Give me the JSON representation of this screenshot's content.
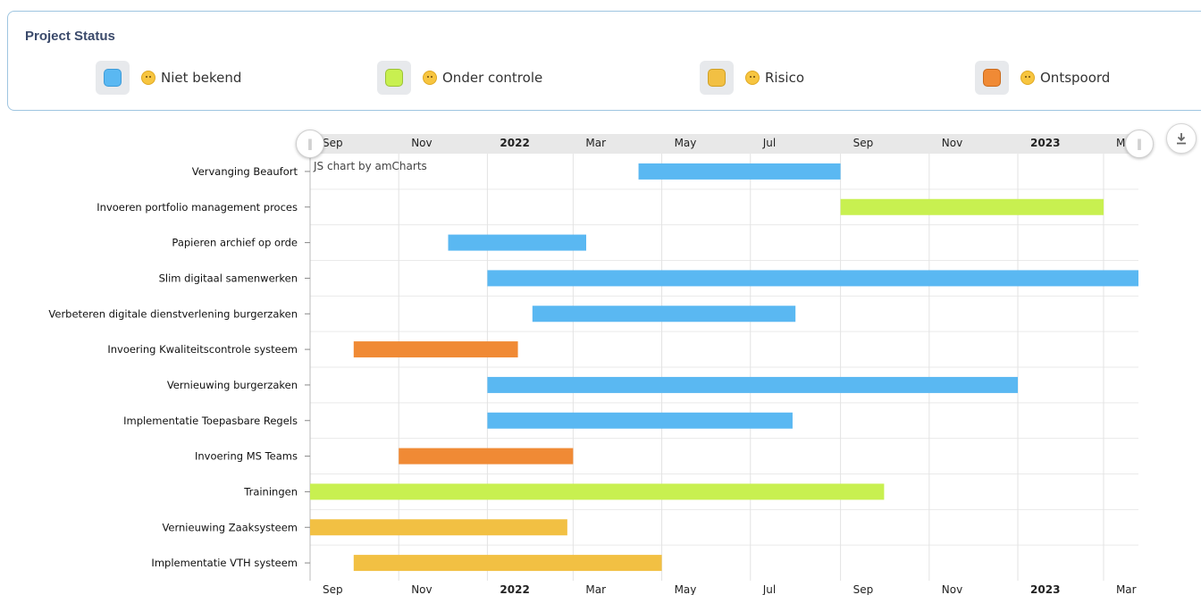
{
  "status_panel": {
    "title": "Project Status",
    "legend": [
      {
        "label": "Niet bekend",
        "color": "#5ab8f2",
        "icon": "thinking-face-icon"
      },
      {
        "label": "Onder controle",
        "color": "#c8f050",
        "icon": "smiling-face-icon"
      },
      {
        "label": "Risico",
        "color": "#f2c043",
        "icon": "slightly-frowning-face-icon"
      },
      {
        "label": "Ontspoord",
        "color": "#f08a35",
        "icon": "worried-face-icon"
      }
    ]
  },
  "chart_data": {
    "type": "gantt",
    "watermark": "JS chart by amCharts",
    "x_range": [
      "2021-09-01",
      "2023-03-25"
    ],
    "x_tick_labels": [
      {
        "label": "Sep",
        "date": "2021-09-01",
        "bold": false
      },
      {
        "label": "Nov",
        "date": "2021-11-01",
        "bold": false
      },
      {
        "label": "2022",
        "date": "2022-01-01",
        "bold": true
      },
      {
        "label": "Mar",
        "date": "2022-03-01",
        "bold": false
      },
      {
        "label": "May",
        "date": "2022-05-01",
        "bold": false
      },
      {
        "label": "Jul",
        "date": "2022-07-01",
        "bold": false
      },
      {
        "label": "Sep",
        "date": "2022-09-01",
        "bold": false
      },
      {
        "label": "Nov",
        "date": "2022-11-01",
        "bold": false
      },
      {
        "label": "2023",
        "date": "2023-01-01",
        "bold": true
      },
      {
        "label": "Mar",
        "date": "2023-03-01",
        "bold": false
      }
    ],
    "categories": [
      "Vervanging Beaufort",
      "Invoeren portfolio management proces",
      "Papieren archief op orde",
      "Slim digitaal samenwerken",
      "Verbeteren digitale dienstverlening burgerzaken",
      "Invoering Kwaliteitscontrole systeem",
      "Vernieuwing burgerzaken",
      "Implementatie Toepasbare Regels",
      "Invoering MS Teams",
      "Trainingen",
      "Vernieuwing Zaaksysteem",
      "Implementatie VTH systeem"
    ],
    "tasks": [
      {
        "name": "Vervanging Beaufort",
        "start": "2022-04-15",
        "end": "2022-09-01",
        "status": "Niet bekend",
        "color": "#5ab8f2"
      },
      {
        "name": "Invoeren portfolio management proces",
        "start": "2022-09-01",
        "end": "2023-03-01",
        "status": "Onder controle",
        "color": "#c8f050"
      },
      {
        "name": "Papieren archief op orde",
        "start": "2021-12-05",
        "end": "2022-03-10",
        "status": "Niet bekend",
        "color": "#5ab8f2"
      },
      {
        "name": "Slim digitaal samenwerken",
        "start": "2022-01-01",
        "end": "2023-03-31",
        "status": "Niet bekend",
        "color": "#5ab8f2"
      },
      {
        "name": "Verbeteren digitale dienstverlening burgerzaken",
        "start": "2022-02-01",
        "end": "2022-08-01",
        "status": "Niet bekend",
        "color": "#5ab8f2"
      },
      {
        "name": "Invoering Kwaliteitscontrole systeem",
        "start": "2021-10-01",
        "end": "2022-01-22",
        "status": "Ontspoord",
        "color": "#f08a35"
      },
      {
        "name": "Vernieuwing burgerzaken",
        "start": "2022-01-01",
        "end": "2023-01-01",
        "status": "Niet bekend",
        "color": "#5ab8f2"
      },
      {
        "name": "Implementatie Toepasbare Regels",
        "start": "2022-01-01",
        "end": "2022-07-30",
        "status": "Niet bekend",
        "color": "#5ab8f2"
      },
      {
        "name": "Invoering MS Teams",
        "start": "2021-11-01",
        "end": "2022-03-01",
        "status": "Ontspoord",
        "color": "#f08a35"
      },
      {
        "name": "Trainingen",
        "start": "2021-09-01",
        "end": "2022-10-01",
        "status": "Onder controle",
        "color": "#c8f050"
      },
      {
        "name": "Vernieuwing Zaaksysteem",
        "start": "2021-09-01",
        "end": "2022-02-25",
        "status": "Risico",
        "color": "#f2c043"
      },
      {
        "name": "Implementatie VTH systeem",
        "start": "2021-10-01",
        "end": "2022-05-01",
        "status": "Risico",
        "color": "#f2c043"
      }
    ],
    "grid": true
  }
}
